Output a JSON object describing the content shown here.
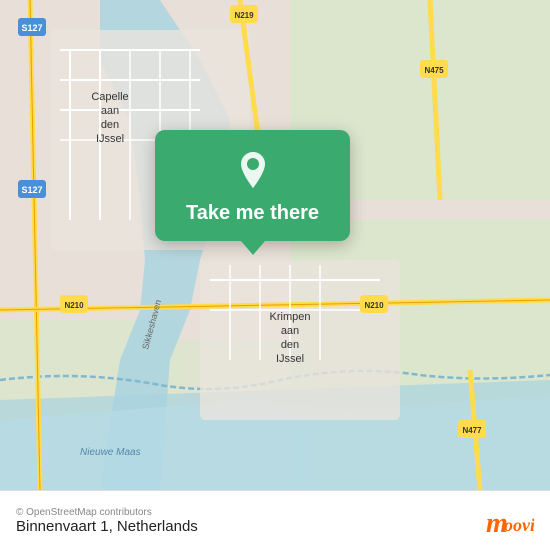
{
  "map": {
    "background_color": "#e8e0d8",
    "water_color": "#aad3df",
    "green_color": "#c8e6c9",
    "road_color": "#f5f1e8",
    "highway_color": "#ffd700"
  },
  "popup": {
    "label": "Take me there",
    "background_color": "#3aaa6e",
    "pin_color": "#ffffff"
  },
  "footer": {
    "address": "Binnenvaart 1, Netherlands",
    "osm_credit": "© OpenStreetMap contributors",
    "moovit_brand": "moovit",
    "moovit_color": "#ff6600"
  },
  "labels": {
    "capelle": "Capelle\naan\nden\nIJssel",
    "krimpen": "Krimpen\naan\nden\nIJssel",
    "route_s127": "S127",
    "route_n210": "N210",
    "route_n219": "N219",
    "route_n475": "N475",
    "route_n477": "N477",
    "route_sikkeshaven": "Sikkeshaven",
    "route_nieuwe_maas": "Nieuwe Maas"
  }
}
